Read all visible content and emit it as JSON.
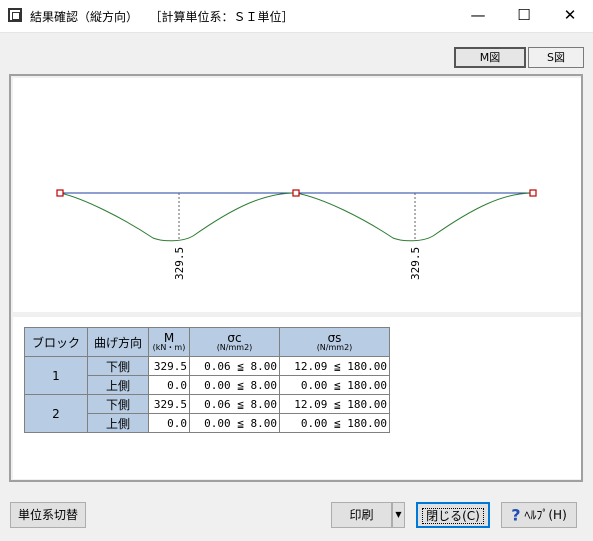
{
  "window": {
    "title": "結果確認（縦方向）",
    "subtitle": "［計算単位系：ＳＩ単位］",
    "minimize": "—",
    "maximize": "☐",
    "close": "✕"
  },
  "tabs": [
    {
      "label": "M図",
      "active": true
    },
    {
      "label": "S図",
      "active": false
    }
  ],
  "diagram": {
    "value_labels": [
      "329.5",
      "329.5"
    ],
    "colors": {
      "axis": "#1f3f9f",
      "curve": "#2e7d32",
      "node": "#c00000",
      "guide": "#606060"
    }
  },
  "table": {
    "headers": [
      "ブロック",
      "曲げ方向",
      "M",
      "σc",
      "σs"
    ],
    "units": [
      "(kN・m)",
      "(N/mm2)",
      "(N/mm2)"
    ],
    "rows": [
      {
        "block": "1",
        "direction": "下側",
        "m": "329.5",
        "sc": "0.06 ≦ 8.00",
        "ss": "12.09 ≦ 180.00"
      },
      {
        "block": "",
        "direction": "上側",
        "m": "0.0",
        "sc": "0.00 ≦ 8.00",
        "ss": "0.00 ≦ 180.00"
      },
      {
        "block": "2",
        "direction": "下側",
        "m": "329.5",
        "sc": "0.06 ≦ 8.00",
        "ss": "12.09 ≦ 180.00"
      },
      {
        "block": "",
        "direction": "上側",
        "m": "0.0",
        "sc": "0.00 ≦ 8.00",
        "ss": "0.00 ≦ 180.00"
      }
    ]
  },
  "buttons": {
    "unit_switch": "単位系切替",
    "print": "印刷",
    "close": "閉じる(C)",
    "help": "ﾍﾙﾌﾟ(H)"
  },
  "help_icon": "question-mark-icon",
  "accent": "#b8cce4"
}
